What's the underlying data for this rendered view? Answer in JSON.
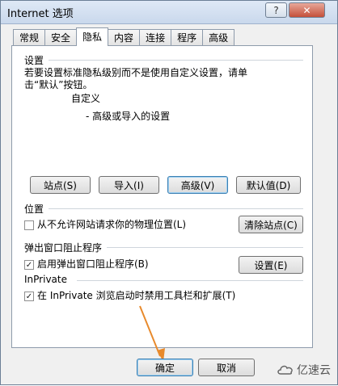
{
  "window": {
    "title": "Internet 选项"
  },
  "titlebar_buttons": {
    "help": "?",
    "close": "✕"
  },
  "tabs": [
    {
      "label": "常规"
    },
    {
      "label": "安全"
    },
    {
      "label": "隐私"
    },
    {
      "label": "内容"
    },
    {
      "label": "连接"
    },
    {
      "label": "程序"
    },
    {
      "label": "高级"
    }
  ],
  "settings": {
    "heading": "设置",
    "line1": "若要设置标准隐私级别而不是使用自定义设置，请单",
    "line2": "击“默认”按钮。",
    "level_title": "自定义",
    "level_desc": "- 高级或导入的设置",
    "buttons": {
      "sites": "站点(S)",
      "import": "导入(I)",
      "advanced": "高级(V)",
      "default": "默认值(D)"
    }
  },
  "location": {
    "heading": "位置",
    "checkbox_label": "从不允许网站请求你的物理位置(L)",
    "checkbox_checked": false,
    "clear_button": "清除站点(C)"
  },
  "popup": {
    "heading": "弹出窗口阻止程序",
    "checkbox_label": "启用弹出窗口阻止程序(B)",
    "checkbox_checked": true,
    "settings_button": "设置(E)"
  },
  "inprivate": {
    "heading": "InPrivate",
    "checkbox_label": "在 InPrivate 浏览启动时禁用工具栏和扩展(T)",
    "checkbox_checked": true
  },
  "footer": {
    "ok": "确定",
    "cancel": "取消"
  },
  "watermark": {
    "text": "亿速云"
  }
}
